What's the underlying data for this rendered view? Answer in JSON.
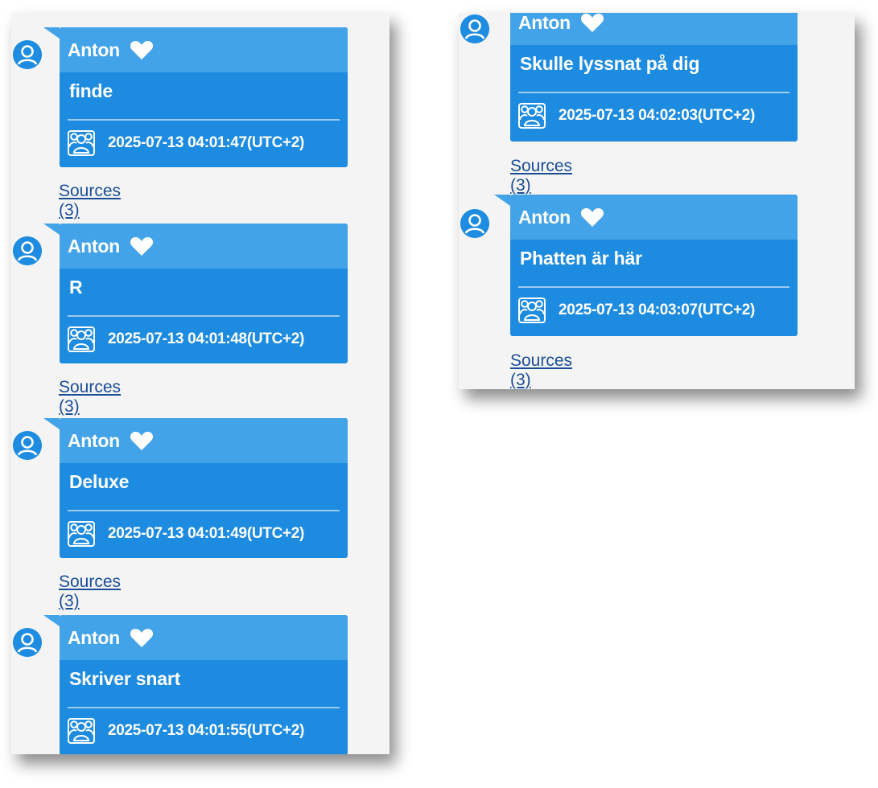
{
  "messages_left": [
    {
      "sender": "Anton",
      "text": "finde",
      "timestamp": "2025-07-13 04:01:47(UTC+2)",
      "sources": "Sources (3)"
    },
    {
      "sender": "Anton",
      "text": "R",
      "timestamp": "2025-07-13 04:01:48(UTC+2)",
      "sources": "Sources (3)"
    },
    {
      "sender": "Anton",
      "text": "Deluxe",
      "timestamp": "2025-07-13 04:01:49(UTC+2)",
      "sources": "Sources (3)"
    },
    {
      "sender": "Anton",
      "text": "Skriver snart",
      "timestamp": "2025-07-13 04:01:55(UTC+2)"
    }
  ],
  "messages_right": [
    {
      "sender": "Anton",
      "text": "Skulle lyssnat på dig",
      "timestamp": "2025-07-13 04:02:03(UTC+2)",
      "sources": "Sources (3)"
    },
    {
      "sender": "Anton",
      "text": "Phatten är här",
      "timestamp": "2025-07-13 04:03:07(UTC+2)",
      "sources": "Sources (3)"
    }
  ],
  "icons": {
    "avatar": "user-avatar-icon",
    "favorite": "heart-icon",
    "group": "group-icon"
  },
  "colors": {
    "bubble": "#1d8be0",
    "bubble_header": "#42a3e8",
    "link": "#1a4d97",
    "panel": "#f4f4f4"
  }
}
